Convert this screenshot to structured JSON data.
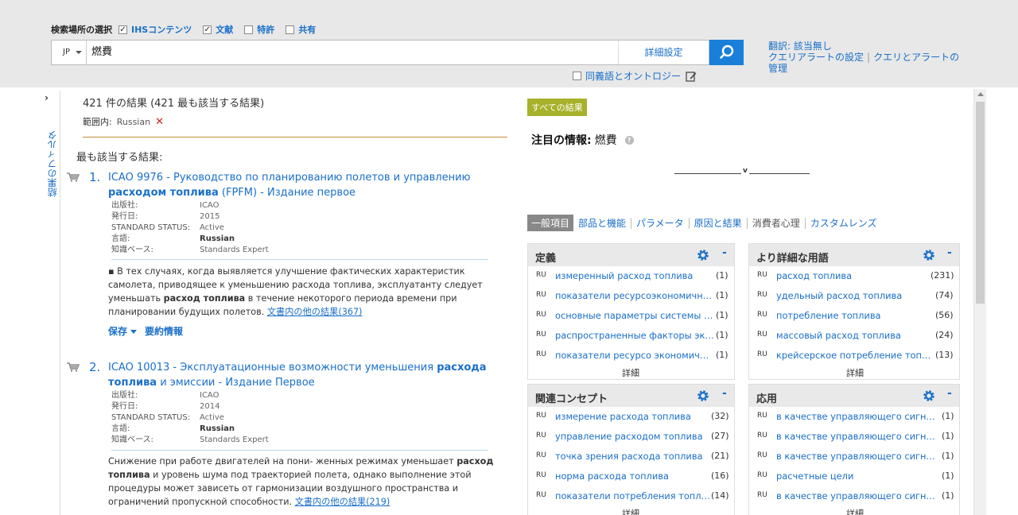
{
  "header": {
    "scope_label": "検索場所の選択",
    "scopes": [
      {
        "label": "IHSコンテンツ",
        "checked": true
      },
      {
        "label": "文献",
        "checked": true
      },
      {
        "label": "特許",
        "checked": false
      },
      {
        "label": "共有",
        "checked": false
      }
    ],
    "lang": "JP",
    "query": "燃費",
    "advanced": "詳細設定",
    "synonyms": "同義語とオントロジー",
    "translation": "翻訳: 該当無し",
    "query_alert_settings": "クエリアラートの設定",
    "query_alert_manage_1": "クエリとアラートの",
    "query_alert_manage_2": "管理"
  },
  "sidebar": {
    "filter_label": "結果のフィルタ"
  },
  "results": {
    "count_text": "421 件の結果 (421 最も該当する結果)",
    "scope_label": "範囲内:",
    "scope_value": "Russian",
    "best_label": "最も該当する結果:",
    "items": [
      {
        "num": "1.",
        "title_a": "ICAO 9976 - Руководство по планированию полетов и управлению ",
        "title_b": "расходом топлива",
        "title_c": " (FPFM) - Издание первое",
        "meta": [
          {
            "k": "出版社:",
            "v": "ICAO"
          },
          {
            "k": "発行日:",
            "v": "2015"
          },
          {
            "k": "STANDARD STATUS:",
            "v": "Active"
          },
          {
            "k": "言語:",
            "v": "Russian"
          },
          {
            "k": "知識ベース:",
            "v": "Standards Expert"
          }
        ],
        "snip_a": "▪ В тех случаях, когда выявляется улучшение фактических характеристик самолета, приводящее к уменьшению расхода топлива, эксплуатанту следует уменьшать ",
        "snip_b": "расход топлива",
        "snip_c": " в течение некоторого периода времени при планировании будущих полетов. ",
        "more": "文書内の他の結果(367)",
        "save": "保存",
        "summary": "要約情報"
      },
      {
        "num": "2.",
        "title_a": "ICAO 10013 - Эксплуатационные возможности уменьшения ",
        "title_b": "расхода топлива",
        "title_c": " и эмиссии - Издание Первое",
        "meta": [
          {
            "k": "出版社:",
            "v": "ICAO"
          },
          {
            "k": "発行日:",
            "v": "2014"
          },
          {
            "k": "STANDARD STATUS:",
            "v": "Active"
          },
          {
            "k": "言語:",
            "v": "Russian"
          },
          {
            "k": "知識ベース:",
            "v": "Standards Expert"
          }
        ],
        "snip_a": "Снижение при работе двигателей на пони- женных режимах уменьшает ",
        "snip_b": "расход топлива",
        "snip_c": " и уровень шума под траекторией полета, однако выполнение этой процедуры может зависеть от гармонизации воздушного пространства и ограничений пропускной способности. ",
        "more": "文書内の他の結果(219)"
      }
    ]
  },
  "right": {
    "all_results": "すべての結果",
    "spotlight_label": "注目の情報:",
    "spotlight_query": "燃費",
    "lenses": [
      "一般項目",
      "部品と機能",
      "パラメータ",
      "原因と結果",
      "消費者心理",
      "カスタムレンズ"
    ],
    "panels": [
      {
        "title": "定義",
        "rows": [
          {
            "lang": "RU",
            "text": "измеренный расход топлива",
            "count": "(1)"
          },
          {
            "lang": "RU",
            "text": "показатели ресурсоэкономичности",
            "count": "(1)"
          },
          {
            "lang": "RU",
            "text": "основные параметры системы воздушного",
            "count": "(1)"
          },
          {
            "lang": "RU",
            "text": "распространенные факторы экономии",
            "count": "(1)"
          },
          {
            "lang": "RU",
            "text": "показатели ресурсо экономичности",
            "count": "(1)"
          }
        ],
        "detail": "詳細"
      },
      {
        "title": "より詳細な用語",
        "rows": [
          {
            "lang": "RU",
            "text": "расход топлива",
            "count": "(231)"
          },
          {
            "lang": "RU",
            "text": "удельный расход топлива",
            "count": "(74)"
          },
          {
            "lang": "RU",
            "text": "потребление топлива",
            "count": "(56)"
          },
          {
            "lang": "RU",
            "text": "массовый расход топлива",
            "count": "(24)"
          },
          {
            "lang": "RU",
            "text": "крейсерское потребление топлива",
            "count": "(13)"
          }
        ],
        "detail": "詳細"
      },
      {
        "title": "関連コンセプト",
        "rows": [
          {
            "lang": "RU",
            "text": "измерение расхода топлива",
            "count": "(32)"
          },
          {
            "lang": "RU",
            "text": "управление расходом топлива",
            "count": "(27)"
          },
          {
            "lang": "RU",
            "text": "точка зрения расхода топлива",
            "count": "(21)"
          },
          {
            "lang": "RU",
            "text": "норма расхода топлива",
            "count": "(16)"
          },
          {
            "lang": "RU",
            "text": "показатели потребления топлива",
            "count": "(14)"
          }
        ],
        "detail": "詳細"
      },
      {
        "title": "応用",
        "rows": [
          {
            "lang": "RU",
            "text": "в качестве управляющего сигнала",
            "count": "(1)"
          },
          {
            "lang": "RU",
            "text": "в качестве управляющего сигнала",
            "count": "(1)"
          },
          {
            "lang": "RU",
            "text": "в качестве управляющего сигнала",
            "count": "(1)"
          },
          {
            "lang": "RU",
            "text": "расчетные цели",
            "count": "(1)"
          },
          {
            "lang": "RU",
            "text": "в качестве управляющего сигнала",
            "count": "(1)"
          }
        ],
        "detail": "詳細"
      }
    ]
  },
  "colors": {
    "accent": "#1a6fc9",
    "search_button": "#1a7fd8",
    "badge": "#a7b12a",
    "divider": "#c98e3a"
  }
}
